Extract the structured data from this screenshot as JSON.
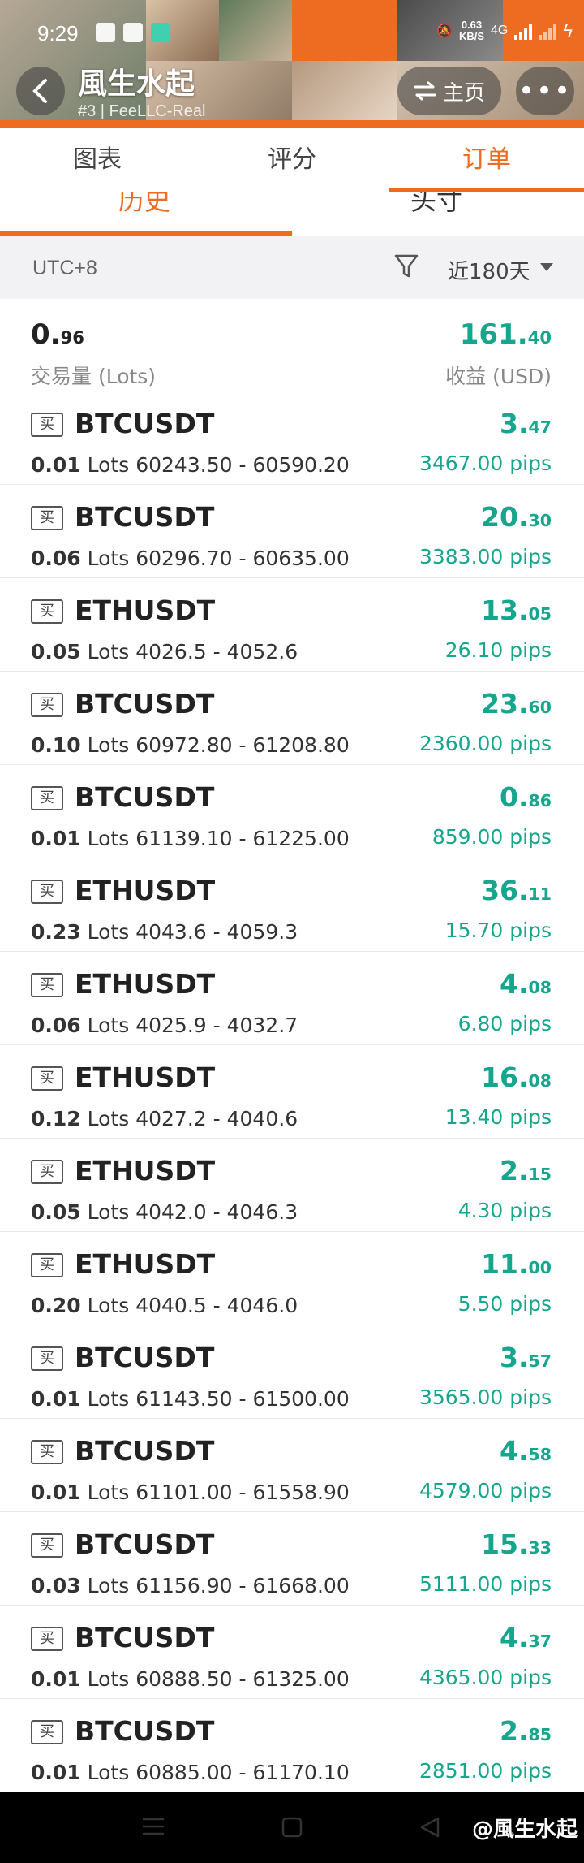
{
  "status_bar": {
    "time": "9:29",
    "net_speed_value": "0.63",
    "net_speed_unit": "KB/S",
    "network": "4G"
  },
  "header": {
    "title": "風生水起",
    "subtitle": "#3 | FeeLLC-Real",
    "home_label": "主页",
    "more_label": "•••"
  },
  "tabs": [
    {
      "label": "图表",
      "active": false
    },
    {
      "label": "评分",
      "active": false
    },
    {
      "label": "订单",
      "active": true
    }
  ],
  "subtabs": [
    {
      "label": "历史",
      "active": true
    },
    {
      "label": "头寸",
      "active": false
    }
  ],
  "filter": {
    "timezone": "UTC+8",
    "range": "近180天"
  },
  "summary": {
    "volume_int": "0.",
    "volume_dec": "96",
    "volume_label": "交易量 (Lots)",
    "profit_int": "161.",
    "profit_dec": "40",
    "profit_label": "收益 (USD)"
  },
  "orders": [
    {
      "side": "买",
      "symbol": "BTCUSDT",
      "lots": "0.01",
      "lots_unit": "Lots",
      "open": "60243.50",
      "close": "60590.20",
      "profit_int": "3.",
      "profit_dec": "47",
      "pips": "3467.00 pips"
    },
    {
      "side": "买",
      "symbol": "BTCUSDT",
      "lots": "0.06",
      "lots_unit": "Lots",
      "open": "60296.70",
      "close": "60635.00",
      "profit_int": "20.",
      "profit_dec": "30",
      "pips": "3383.00 pips"
    },
    {
      "side": "买",
      "symbol": "ETHUSDT",
      "lots": "0.05",
      "lots_unit": "Lots",
      "open": "4026.5",
      "close": "4052.6",
      "profit_int": "13.",
      "profit_dec": "05",
      "pips": "26.10 pips"
    },
    {
      "side": "买",
      "symbol": "BTCUSDT",
      "lots": "0.10",
      "lots_unit": "Lots",
      "open": "60972.80",
      "close": "61208.80",
      "profit_int": "23.",
      "profit_dec": "60",
      "pips": "2360.00 pips"
    },
    {
      "side": "买",
      "symbol": "BTCUSDT",
      "lots": "0.01",
      "lots_unit": "Lots",
      "open": "61139.10",
      "close": "61225.00",
      "profit_int": "0.",
      "profit_dec": "86",
      "pips": "859.00 pips"
    },
    {
      "side": "买",
      "symbol": "ETHUSDT",
      "lots": "0.23",
      "lots_unit": "Lots",
      "open": "4043.6",
      "close": "4059.3",
      "profit_int": "36.",
      "profit_dec": "11",
      "pips": "15.70 pips"
    },
    {
      "side": "买",
      "symbol": "ETHUSDT",
      "lots": "0.06",
      "lots_unit": "Lots",
      "open": "4025.9",
      "close": "4032.7",
      "profit_int": "4.",
      "profit_dec": "08",
      "pips": "6.80 pips"
    },
    {
      "side": "买",
      "symbol": "ETHUSDT",
      "lots": "0.12",
      "lots_unit": "Lots",
      "open": "4027.2",
      "close": "4040.6",
      "profit_int": "16.",
      "profit_dec": "08",
      "pips": "13.40 pips"
    },
    {
      "side": "买",
      "symbol": "ETHUSDT",
      "lots": "0.05",
      "lots_unit": "Lots",
      "open": "4042.0",
      "close": "4046.3",
      "profit_int": "2.",
      "profit_dec": "15",
      "pips": "4.30 pips"
    },
    {
      "side": "买",
      "symbol": "ETHUSDT",
      "lots": "0.20",
      "lots_unit": "Lots",
      "open": "4040.5",
      "close": "4046.0",
      "profit_int": "11.",
      "profit_dec": "00",
      "pips": "5.50 pips"
    },
    {
      "side": "买",
      "symbol": "BTCUSDT",
      "lots": "0.01",
      "lots_unit": "Lots",
      "open": "61143.50",
      "close": "61500.00",
      "profit_int": "3.",
      "profit_dec": "57",
      "pips": "3565.00 pips"
    },
    {
      "side": "买",
      "symbol": "BTCUSDT",
      "lots": "0.01",
      "lots_unit": "Lots",
      "open": "61101.00",
      "close": "61558.90",
      "profit_int": "4.",
      "profit_dec": "58",
      "pips": "4579.00 pips"
    },
    {
      "side": "买",
      "symbol": "BTCUSDT",
      "lots": "0.03",
      "lots_unit": "Lots",
      "open": "61156.90",
      "close": "61668.00",
      "profit_int": "15.",
      "profit_dec": "33",
      "pips": "5111.00 pips"
    },
    {
      "side": "买",
      "symbol": "BTCUSDT",
      "lots": "0.01",
      "lots_unit": "Lots",
      "open": "60888.50",
      "close": "61325.00",
      "profit_int": "4.",
      "profit_dec": "37",
      "pips": "4365.00 pips"
    },
    {
      "side": "买",
      "symbol": "BTCUSDT",
      "lots": "0.01",
      "lots_unit": "Lots",
      "open": "60885.00",
      "close": "61170.10",
      "profit_int": "2.",
      "profit_dec": "85",
      "pips": "2851.00 pips"
    }
  ],
  "watermark": "@風生水起",
  "colors": {
    "accent": "#ee6b22",
    "profit": "#16a58d"
  },
  "icons": [
    "back-arrow-icon",
    "swap-icon",
    "more-icon",
    "filter-icon",
    "caret-down-icon",
    "menu-icon",
    "home-icon",
    "back-nav-icon"
  ]
}
